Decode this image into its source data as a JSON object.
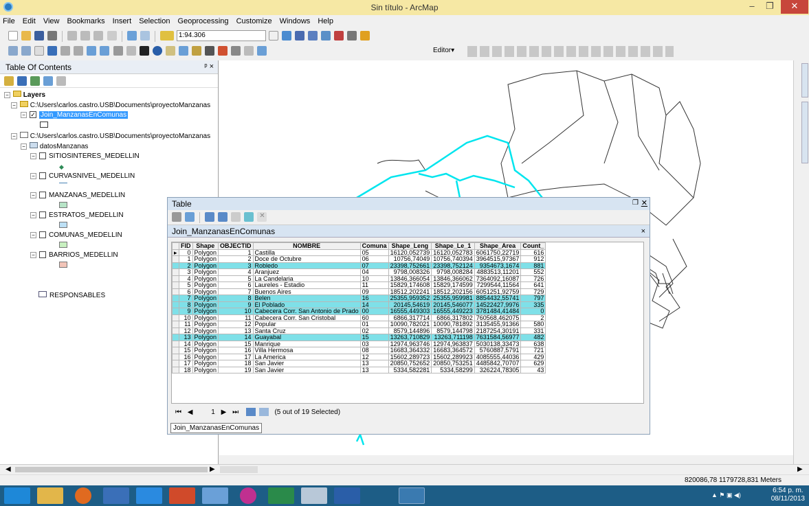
{
  "window": {
    "title": "Sin título - ArcMap"
  },
  "menu": [
    "File",
    "Edit",
    "View",
    "Bookmarks",
    "Insert",
    "Selection",
    "Geoprocessing",
    "Customize",
    "Windows",
    "Help"
  ],
  "toolbar": {
    "scale": "1:94.306",
    "editor_label": "Editor▾"
  },
  "toc": {
    "title": "Table Of Contents",
    "pin": "ᵖ ×",
    "layers_label": "Layers",
    "path1": "C:\\Users\\carlos.castro.USB\\Documents\\proyectoManzanas",
    "join_layer": "Join_ManzanasEnComunas",
    "path2": "C:\\Users\\carlos.castro.USB\\Documents\\proyectoManzanas",
    "dataset": "datosManzanas",
    "layers": [
      {
        "name": "SITIOSINTERES_MEDELLIN",
        "swatch": "#2e8b57"
      },
      {
        "name": "CURVASNIVEL_MEDELLIN",
        "swatch": "#4682b4"
      },
      {
        "name": "MANZANAS_MEDELLIN",
        "swatch": "#b7e4c7"
      },
      {
        "name": "ESTRATOS_MEDELLIN",
        "swatch": "#bde0f5"
      },
      {
        "name": "COMUNAS_MEDELLIN",
        "swatch": "#c8f0c0"
      },
      {
        "name": "BARRIOS_MEDELLIN",
        "swatch": "#f2c4b8"
      }
    ],
    "table_item": "RESPONSABLES"
  },
  "table_window": {
    "caption": "Table",
    "tab_title": "Join_ManzanasEnComunas",
    "columns": [
      "FID",
      "Shape",
      "OBJECTID",
      "NOMBRE",
      "Comuna",
      "Shape_Leng",
      "Shape_Le_1",
      "Shape_Area",
      "Count_"
    ],
    "rows": [
      [
        "0",
        "Polygon",
        "1",
        "Castilla",
        "05",
        "16120,052739",
        "16120,052783",
        "6061750,22719",
        "616"
      ],
      [
        "1",
        "Polygon",
        "2",
        "Doce de Octubre",
        "06",
        "10756,74049",
        "10756,740394",
        "3964515,97367",
        "912"
      ],
      [
        "2",
        "Polygon",
        "3",
        "Robledo",
        "07",
        "23398,752661",
        "23398,752124",
        "9354673,1674",
        "881"
      ],
      [
        "3",
        "Polygon",
        "4",
        "Aranjuez",
        "04",
        "9798,008326",
        "9798,008284",
        "4883513,11201",
        "552"
      ],
      [
        "4",
        "Polygon",
        "5",
        "La Candelaria",
        "10",
        "13846,366054",
        "13846,366062",
        "7364092,16087",
        "726"
      ],
      [
        "5",
        "Polygon",
        "6",
        "Laureles - Estadio",
        "11",
        "15829,174608",
        "15829,174599",
        "7299544,11564",
        "641"
      ],
      [
        "6",
        "Polygon",
        "7",
        "Buenos Aires",
        "09",
        "18512,202241",
        "18512,202156",
        "6051251,92759",
        "729"
      ],
      [
        "7",
        "Polygon",
        "8",
        "Belen",
        "16",
        "25355,959352",
        "25355,959981",
        "8854432,55741",
        "797"
      ],
      [
        "8",
        "Polygon",
        "9",
        "El Poblado",
        "14",
        "20145,54619",
        "20145,546077",
        "14522427,9976",
        "335"
      ],
      [
        "9",
        "Polygon",
        "10",
        "Cabecera Corr. San Antonio de Prado",
        "00",
        "16555,449303",
        "16555,449223",
        "3781484,41484",
        "0"
      ],
      [
        "10",
        "Polygon",
        "11",
        "Cabecera Corr. San Cristobal",
        "60",
        "6866,317714",
        "6866,317802",
        "760568,462075",
        "2"
      ],
      [
        "11",
        "Polygon",
        "12",
        "Popular",
        "01",
        "10090,782021",
        "10090,781892",
        "3135455,91366",
        "580"
      ],
      [
        "12",
        "Polygon",
        "13",
        "Santa Cruz",
        "02",
        "8579,144896",
        "8579,144798",
        "2187254,30191",
        "331"
      ],
      [
        "13",
        "Polygon",
        "14",
        "Guayabal",
        "15",
        "13263,710829",
        "13263,711198",
        "7631584,56977",
        "482"
      ],
      [
        "14",
        "Polygon",
        "15",
        "Manrique",
        "03",
        "12974,963746",
        "12974,963837",
        "5030138,33473",
        "638"
      ],
      [
        "15",
        "Polygon",
        "16",
        "Villa Hermosa",
        "08",
        "16683,364332",
        "16683,364572",
        "5760887,5791",
        "721"
      ],
      [
        "16",
        "Polygon",
        "17",
        "La America",
        "12",
        "15602,289723",
        "15602,289923",
        "4085555,44036",
        "429"
      ],
      [
        "17",
        "Polygon",
        "18",
        "San Javier",
        "13",
        "20850,752652",
        "20850,753251",
        "4485842,70707",
        "629"
      ],
      [
        "18",
        "Polygon",
        "19",
        "San Javier",
        "13",
        "5334,582281",
        "5334,58299",
        "326224,78305",
        "43"
      ]
    ],
    "selected_rows": [
      2,
      7,
      8,
      9,
      13
    ],
    "nav_page": "1",
    "selection_status": "(5 out of 19 Selected)",
    "bottom_tab": "Join_ManzanasEnComunas"
  },
  "status": {
    "coords": "820086,78  1179728,831 Meters"
  },
  "clock": {
    "time": "6:54 p. m.",
    "date": "08/11/2013"
  },
  "colors": {
    "selection": "#7fe0e8",
    "highlight_outline": "#00e5ee",
    "title_bar": "#f6e8a4"
  }
}
